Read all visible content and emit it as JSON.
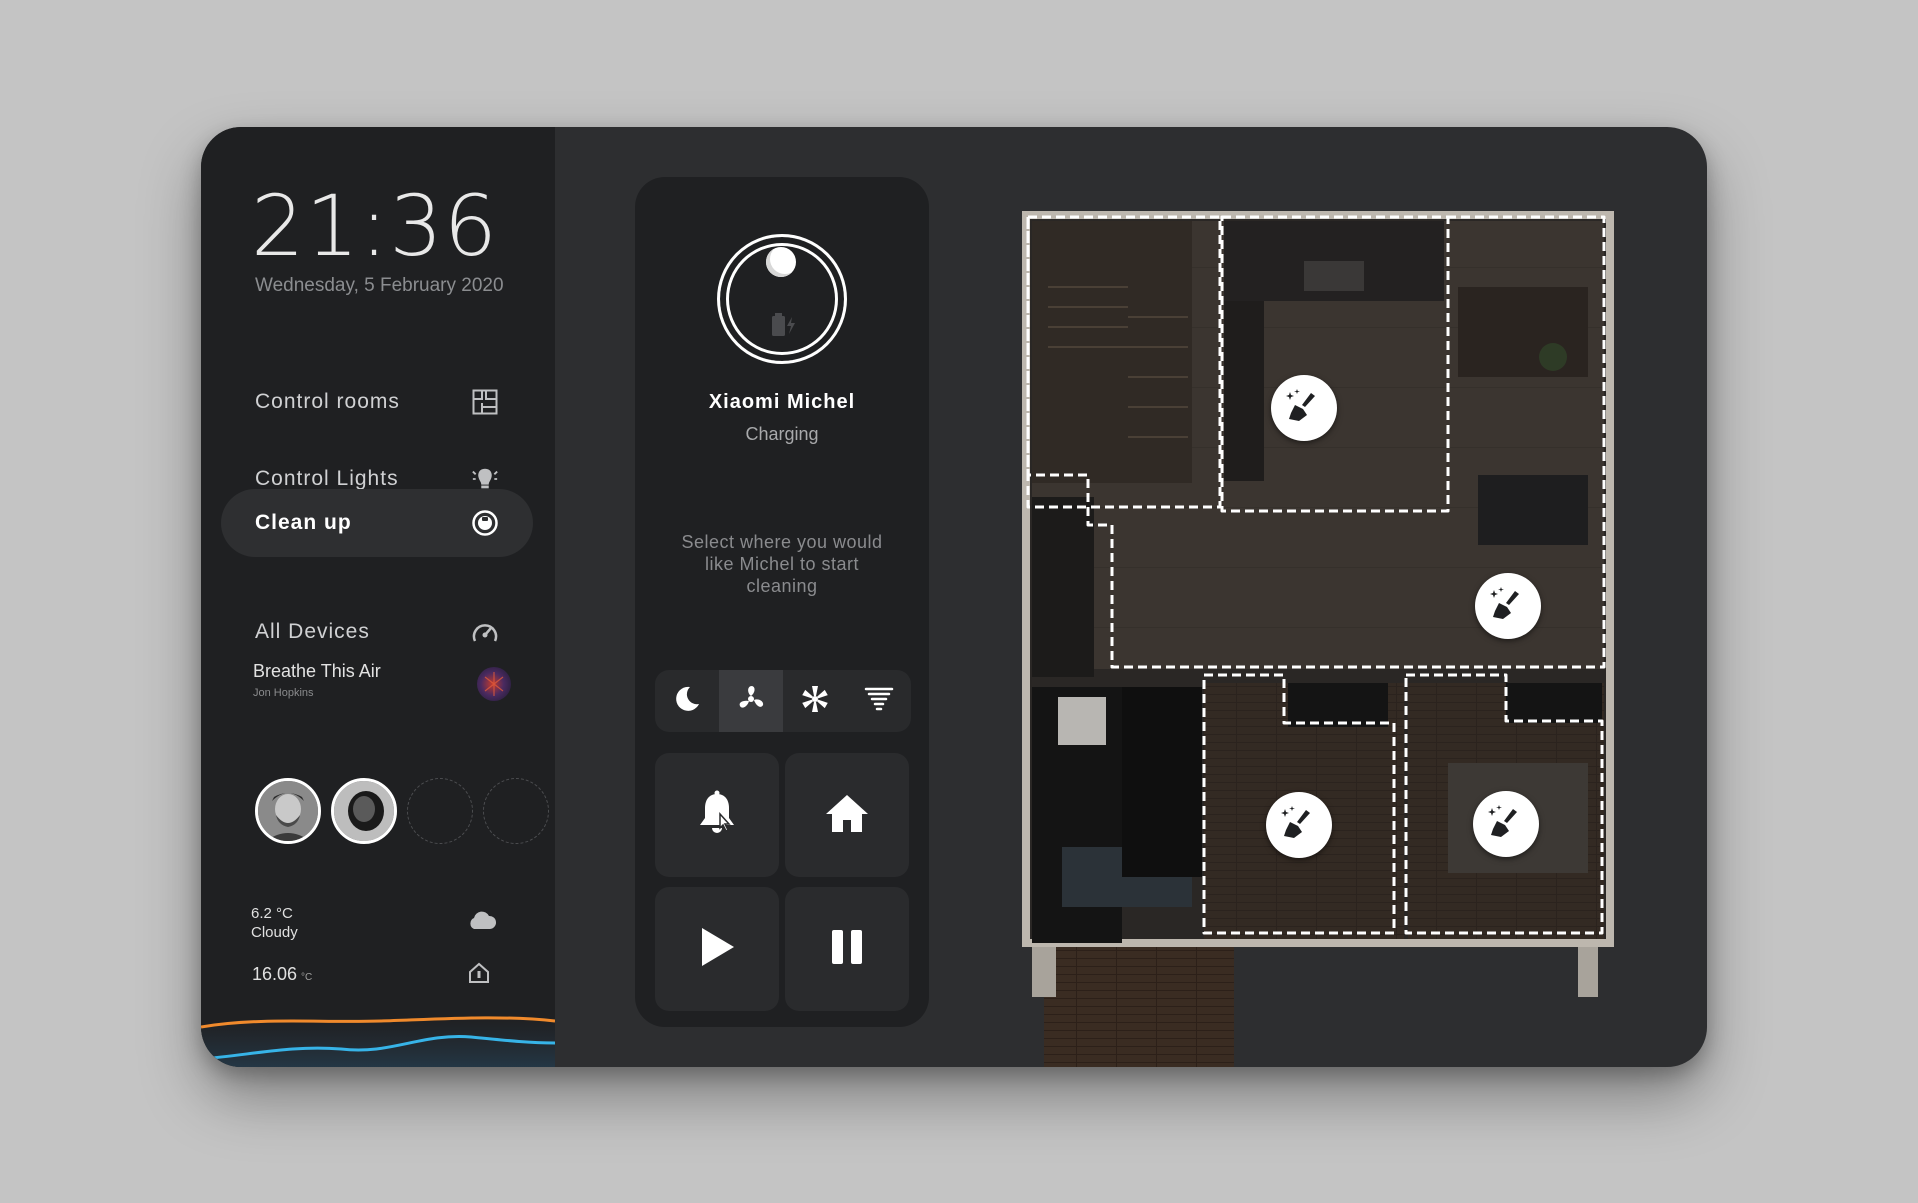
{
  "clock": {
    "time": "21:36",
    "date": "Wednesday, 5 February 2020"
  },
  "nav": {
    "items": [
      {
        "label": "Control rooms",
        "icon": "floorplan-icon"
      },
      {
        "label": "Control Lights",
        "icon": "lights-icon"
      },
      {
        "label": "Clean up",
        "icon": "robot-vacuum-icon",
        "active": true
      },
      {
        "label": "All Devices",
        "icon": "gauge-icon"
      }
    ]
  },
  "music": {
    "title": "Breathe This Air",
    "artist": "Jon Hopkins",
    "art_icon": "album-art"
  },
  "users": {
    "avatars": [
      "user-1",
      "user-2"
    ],
    "empty_slots": 2
  },
  "weather": {
    "temperature": "6.2 °C",
    "condition": "Cloudy",
    "icon": "cloud-icon"
  },
  "indoor": {
    "temperature": "16.06",
    "unit": "°C",
    "icon": "home-temp-icon"
  },
  "device": {
    "name": "Xiaomi Michel",
    "status": "Charging",
    "hint": "Select where you would like Michel to start cleaning",
    "battery_icon": "battery-charging-icon"
  },
  "modes": [
    {
      "name": "quiet",
      "icon": "moon-icon",
      "active": false
    },
    {
      "name": "standard",
      "icon": "fan-icon",
      "active": true
    },
    {
      "name": "strong",
      "icon": "fan-strong-icon",
      "active": false
    },
    {
      "name": "turbo",
      "icon": "tornado-icon",
      "active": false
    }
  ],
  "actions": [
    {
      "name": "locate",
      "icon": "bell-icon"
    },
    {
      "name": "dock",
      "icon": "home-icon"
    },
    {
      "name": "start",
      "icon": "play-icon"
    },
    {
      "name": "pause",
      "icon": "pause-icon"
    }
  ],
  "map": {
    "rooms": [
      "living-room",
      "kitchen",
      "dining-area",
      "bedroom-left",
      "bedroom-right"
    ],
    "clean_icon": "broom-sparkle-icon"
  },
  "colors": {
    "background": "#c4c4c4",
    "device": "#2d2e30",
    "sidebar": "#1f2022",
    "accent_orange": "#f08a2c",
    "accent_blue": "#37b4e8"
  }
}
